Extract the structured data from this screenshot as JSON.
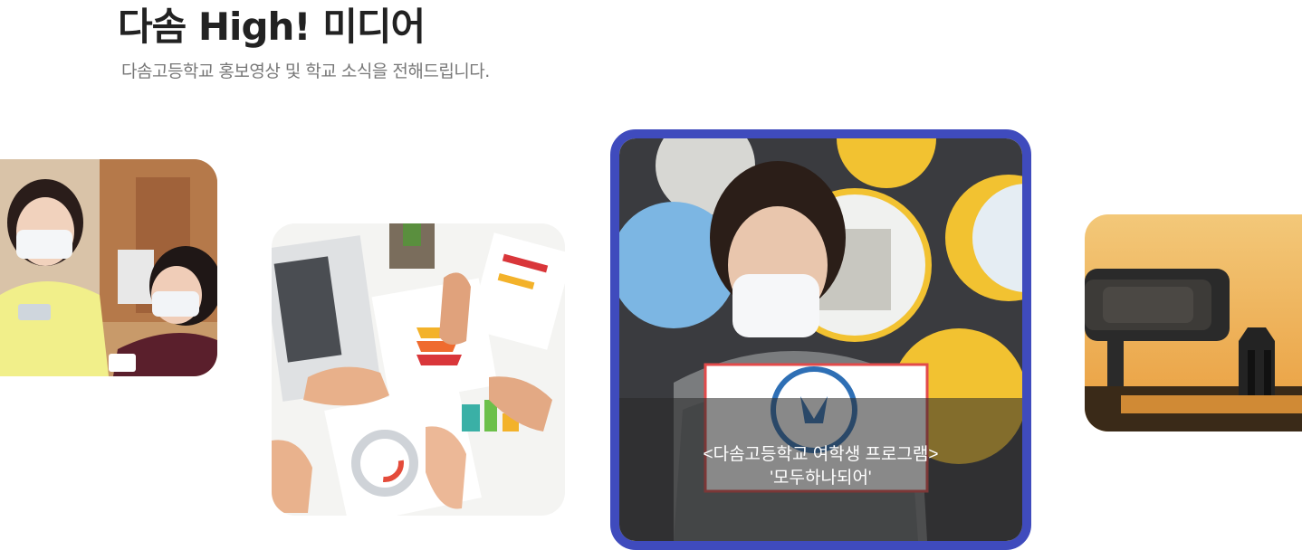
{
  "header": {
    "title": "다솜 High! 미디어",
    "subtitle": "다솜고등학교 홍보영상 및 학교 소식을 전해드립니다."
  },
  "gallery": {
    "items": [
      {
        "image": "students-with-masks-photo"
      },
      {
        "image": "infographic-desk-photo"
      },
      {
        "image": "teacher-stay-strong-sign-photo",
        "active": true,
        "caption_line1": "<다솜고등학교 여학생 프로그램>",
        "caption_line2": "'모두하나되어'"
      },
      {
        "image": "robot-binoculars-photo"
      }
    ],
    "accent_color": "#3f4bbd"
  }
}
